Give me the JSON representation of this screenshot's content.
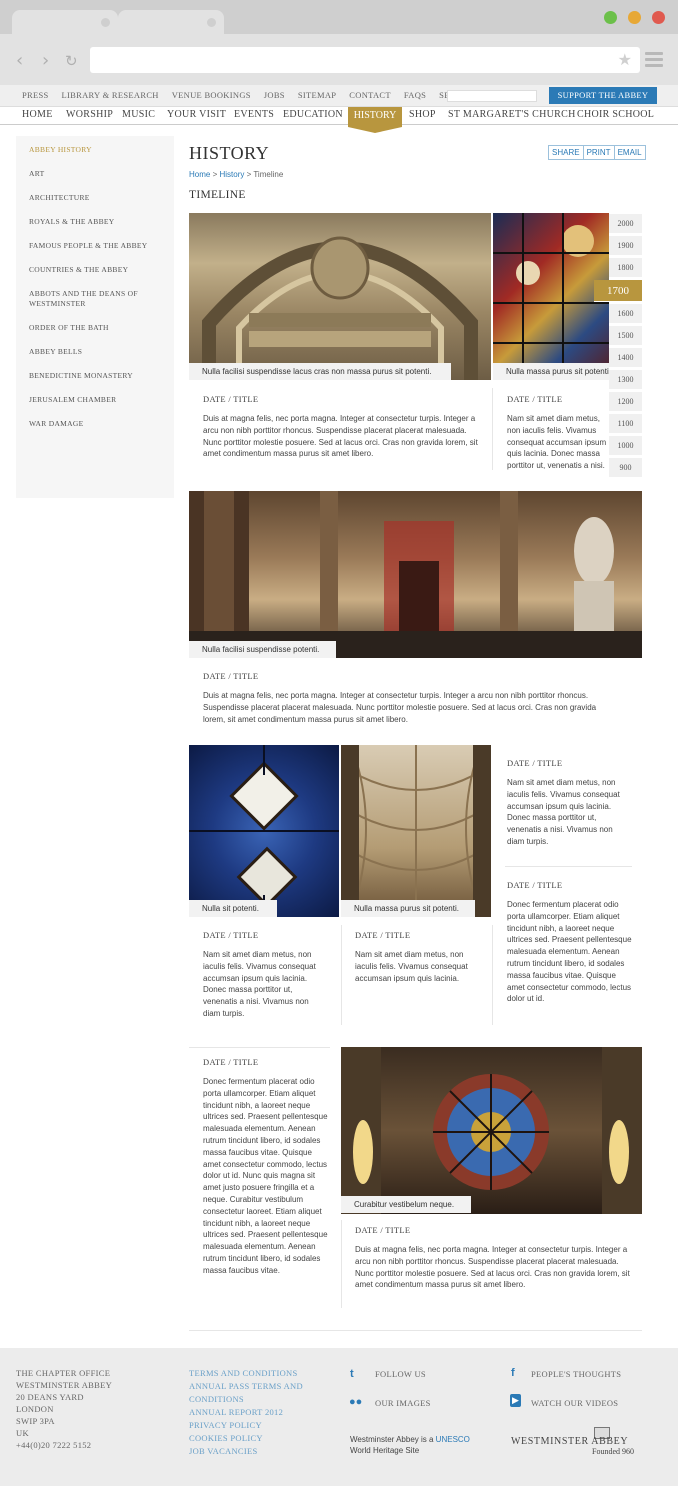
{
  "utility": {
    "links": [
      "PRESS",
      "LIBRARY & RESEARCH",
      "VENUE BOOKINGS",
      "JOBS",
      "SITEMAP",
      "CONTACT",
      "FAQS",
      "SEARCH"
    ],
    "support": "SUPPORT THE ABBEY"
  },
  "nav": {
    "items": [
      "HOME",
      "WORSHIP",
      "MUSIC",
      "YOUR VISIT",
      "EVENTS",
      "EDUCATION",
      "HISTORY",
      "SHOP",
      "ST MARGARET'S CHURCH",
      "CHOIR SCHOOL"
    ],
    "active": "HISTORY"
  },
  "sidebar": {
    "items": [
      "ABBEY HISTORY",
      "ART",
      "ARCHITECTURE",
      "ROYALS & THE ABBEY",
      "FAMOUS PEOPLE & THE ABBEY",
      "COUNTRIES & THE ABBEY",
      "ABBOTS AND THE DEANS OF WESTMINSTER",
      "ORDER OF THE BATH",
      "ABBEY BELLS",
      "BENEDICTINE MONASTERY",
      "JERUSALEM CHAMBER",
      "WAR DAMAGE"
    ]
  },
  "page": {
    "title": "HISTORY",
    "share": [
      "SHARE",
      "PRINT",
      "EMAIL"
    ],
    "breadcrumb": {
      "home": "Home",
      "sep1": " > ",
      "history": "History",
      "sep2": " > ",
      "current": "Timeline"
    },
    "section": "TIMELINE"
  },
  "timeline": {
    "years": [
      "2000",
      "1900",
      "1800",
      "1700",
      "1600",
      "1500",
      "1400",
      "1300",
      "1200",
      "1100",
      "1000",
      "900"
    ],
    "active": "1700"
  },
  "entries": {
    "e1": {
      "caption": "Nulla facilisi suspendisse  lacus cras non massa purus sit potenti.",
      "date": "DATE / TITLE",
      "text": "Duis at magna felis, nec porta magna. Integer at consectetur turpis. Integer a arcu non nibh porttitor rhoncus. Suspendisse placerat placerat malesuada. Nunc porttitor molestie posuere. Sed at lacus orci. Cras non gravida lorem, sit amet condimentum massa purus sit amet libero."
    },
    "e2": {
      "caption": "Nulla massa purus sit potenti.",
      "date": "DATE / TITLE",
      "text": "Nam sit amet diam metus, non iaculis felis. Vivamus consequat accumsan ipsum quis lacinia. Donec massa porttitor ut, venenatis a nisi."
    },
    "e3": {
      "caption": "Nulla facilisi suspendisse potenti.",
      "date": "DATE / TITLE",
      "text": "Duis at magna felis, nec porta magna. Integer at consectetur turpis. Integer a arcu non nibh porttitor rhoncus. Suspendisse placerat placerat malesuada. Nunc porttitor molestie posuere. Sed at lacus orci. Cras non gravida lorem, sit amet condimentum massa purus sit amet libero."
    },
    "e4": {
      "caption": "Nulla sit potenti.",
      "date": "DATE / TITLE",
      "text": "Nam sit amet diam metus, non iaculis felis. Vivamus consequat accumsan ipsum quis lacinia. Donec massa porttitor ut, venenatis a nisi. Vivamus non diam turpis."
    },
    "e5": {
      "caption": "Nulla massa purus sit potenti.",
      "date": "DATE / TITLE",
      "text": "Nam sit amet diam metus, non iaculis felis. Vivamus consequat accumsan ipsum quis lacinia."
    },
    "e6": {
      "date": "DATE / TITLE",
      "text": "Nam sit amet diam metus, non iaculis felis. Vivamus consequat accumsan ipsum quis lacinia. Donec massa  porttitor ut, venenatis a nisi. Vivamus non diam turpis."
    },
    "e7": {
      "date": "DATE / TITLE",
      "text": "Donec fermentum placerat odio porta ullamcorper. Etiam aliquet tincidunt nibh, a laoreet neque ultrices sed. Praesent pellentesque malesuada elementum. Aenean rutrum tincidunt libero, id sodales massa faucibus vitae. Quisque amet consectetur commodo, lectus dolor ut id."
    },
    "e8": {
      "date": "DATE / TITLE",
      "text": "Donec fermentum placerat odio porta ullamcorper. Etiam aliquet tincidunt nibh, a laoreet neque ultrices sed. Praesent pellentesque malesuada elementum. Aenean rutrum tincidunt libero, id sodales massa faucibus vitae. Quisque amet consectetur commodo, lectus dolor ut id. Nunc quis magna sit amet justo posuere fringilla et a neque. Curabitur vestibulum consectetur laoreet. Etiam aliquet tincidunt nibh, a laoreet neque ultrices sed. Praesent pellentesque malesuada elementum. Aenean rutrum tincidunt libero, id sodales massa faucibus vitae."
    },
    "e9": {
      "caption": "Curabitur vestibelum neque.",
      "date": "DATE / TITLE",
      "text": "Duis at magna felis, nec porta magna. Integer at consectetur turpis. Integer a arcu non nibh porttitor rhoncus. Suspendisse placerat placerat malesuada. Nunc porttitor molestie posuere. Sed at lacus orci. Cras non gravida lorem, sit amet condimentum massa purus sit amet libero."
    }
  },
  "window": {
    "traffic_colors": [
      "#6cc04a",
      "#e7a836",
      "#e05a4f"
    ]
  },
  "footer": {
    "address": [
      "THE CHAPTER OFFICE",
      "WESTMINSTER ABBEY",
      "20 DEANS YARD",
      "LONDON",
      "SWIP 3PA",
      "UK",
      "+44(0)20 7222 5152"
    ],
    "links": [
      "TERMS AND CONDITIONS",
      "ANNUAL PASS TERMS AND CONDITIONS",
      "ANNUAL REPORT 2012",
      "PRIVACY POLICY",
      "COOKIES POLICY",
      "JOB VACANCIES"
    ],
    "follow": "FOLLOW US",
    "images": "OUR IMAGES",
    "thoughts": "PEOPLE'S THOUGHTS",
    "videos": "WATCH OUR VIDEOS",
    "whs_prefix": "Westminster Abbey is a ",
    "whs_unesco": "UNESCO",
    "whs_suffix": "World Heritage Site",
    "brand": "WESTMINSTER ABBEY",
    "founded": "Founded 960"
  }
}
